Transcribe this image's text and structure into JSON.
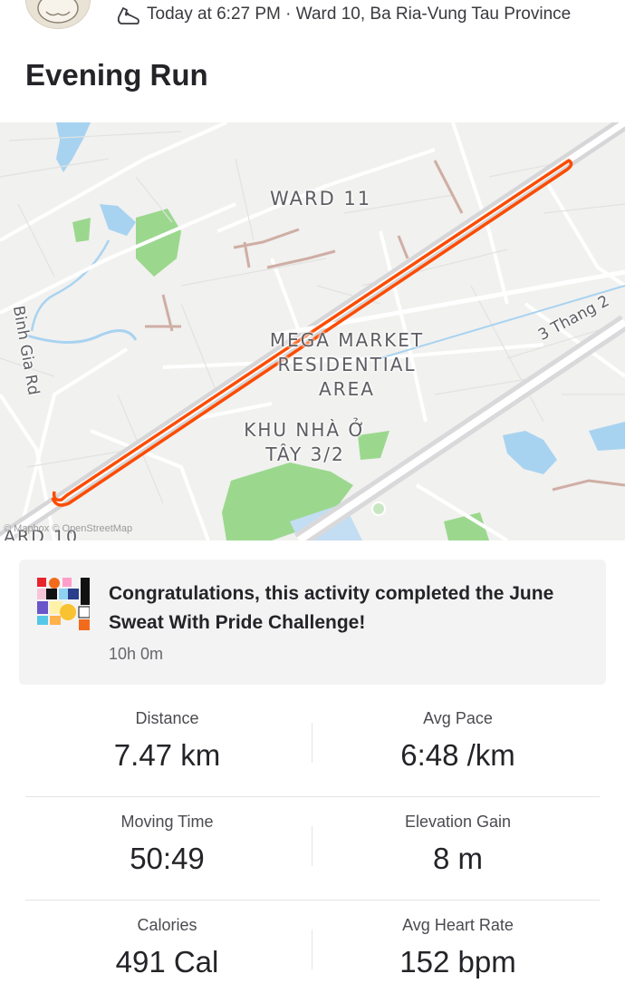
{
  "activity": {
    "meta": "Today at 6:27 PM · Ward 10, Ba Ria-Vung Tau Province",
    "title": "Evening Run",
    "type_icon": "running-shoe-icon"
  },
  "map": {
    "labels": {
      "ward11": "WARD 11",
      "area_line1": "MEGA MARKET",
      "area_line2": "RESIDENTIAL",
      "area_line3": "AREA",
      "khu_line1": "KHU NHÀ Ở",
      "khu_line2": "TÂY 3/2",
      "binh_gia": "Binh Gia Rd",
      "thang": "3 Thang 2",
      "ward10": "ARD 10"
    },
    "attribution": "© Mapbox © OpenStreetMap",
    "route_color": "#fc4c02"
  },
  "challenge": {
    "text": "Congratulations, this activity completed the June Sweat With Pride Challenge!",
    "time": "10h 0m"
  },
  "stats": [
    {
      "left": {
        "label": "Distance",
        "value": "7.47 km"
      },
      "right": {
        "label": "Avg Pace",
        "value": "6:48 /km"
      }
    },
    {
      "left": {
        "label": "Moving Time",
        "value": "50:49"
      },
      "right": {
        "label": "Elevation Gain",
        "value": "8 m"
      }
    },
    {
      "left": {
        "label": "Calories",
        "value": "491 Cal"
      },
      "right": {
        "label": "Avg Heart Rate",
        "value": "152 bpm"
      }
    }
  ]
}
